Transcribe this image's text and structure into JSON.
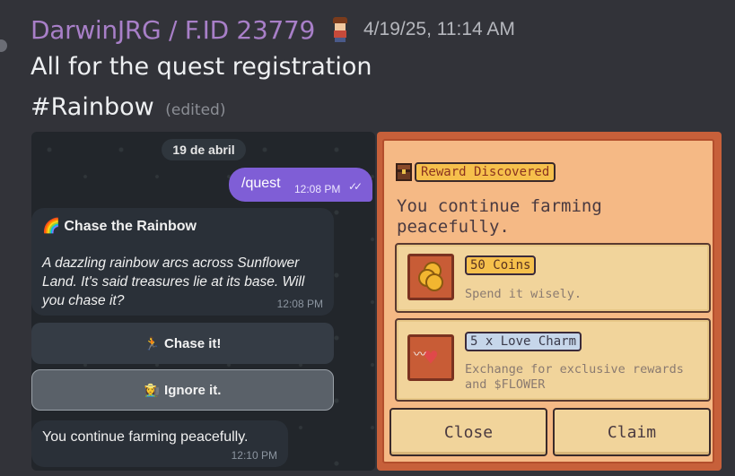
{
  "message": {
    "username": "DarwinJRG / F.ID 23779",
    "timestamp": "4/19/25, 11:14 AM",
    "line1": "All for the quest registration",
    "line2": "#Rainbow",
    "edited_label": "(edited)",
    "role_icon": "farmer-avatar-icon"
  },
  "telegram": {
    "date_pill": "19 de abril",
    "outgoing": {
      "text": "/quest",
      "time": "12:08 PM",
      "status_icon": "double-check-icon"
    },
    "quest_message": {
      "emoji": "🌈",
      "title": "Chase the Rainbow",
      "body": "A dazzling rainbow arcs across Sunflower Land. It's said treasures lie at its base. Will you chase it?",
      "time": "12:08 PM"
    },
    "buttons": [
      {
        "emoji": "🏃",
        "label": "Chase it!"
      },
      {
        "emoji": "👩‍🌾",
        "label": "Ignore it."
      }
    ],
    "reply": {
      "text": "You continue farming peacefully.",
      "time": "12:10 PM"
    }
  },
  "reward_panel": {
    "tag": "Reward Discovered",
    "description": "You continue farming peacefully.",
    "items": [
      {
        "icon": "coins-icon",
        "label": "50 Coins",
        "subtitle": "Spend it wisely."
      },
      {
        "icon": "love-charm-icon",
        "label": "5 x Love Charm",
        "subtitle": "Exchange for exclusive rewards and $FLOWER"
      }
    ],
    "close_label": "Close",
    "claim_label": "Claim"
  },
  "colors": {
    "username": "#a87fc8",
    "telegram_accent": "#7f5ed6",
    "panel_frame": "#c7603a",
    "panel_bg": "#f5b985"
  }
}
